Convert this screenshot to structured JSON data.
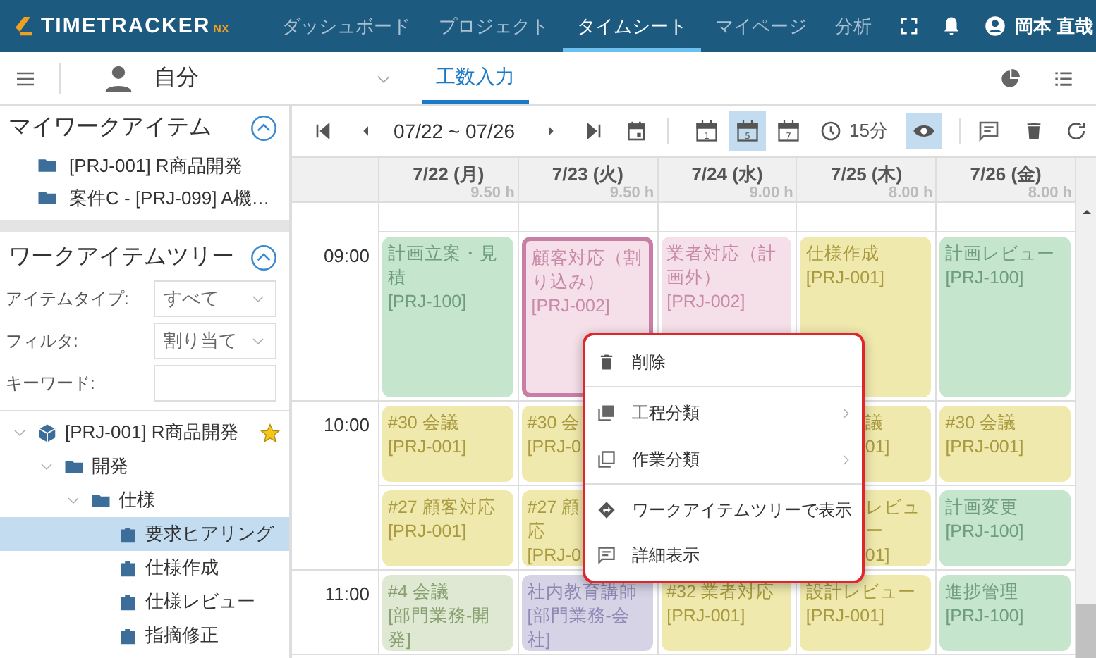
{
  "header": {
    "logo": {
      "text": "TIMETRACKER",
      "suffix": "NX"
    },
    "nav": [
      {
        "label": "ダッシュボード",
        "selected": false
      },
      {
        "label": "プロジェクト",
        "selected": false
      },
      {
        "label": "タイムシート",
        "selected": true
      },
      {
        "label": "マイページ",
        "selected": false
      },
      {
        "label": "分析",
        "selected": false
      }
    ],
    "user": "岡本 直哉"
  },
  "subbar": {
    "person": "自分",
    "tabs": [
      {
        "label": "工数入力",
        "selected": true
      }
    ]
  },
  "my_work_items": {
    "title": "マイワークアイテム",
    "expanded": true,
    "items": [
      {
        "label": "[PRJ-001] R商品開発"
      },
      {
        "label": "案件C - [PRJ-099] A機…"
      }
    ]
  },
  "work_item_tree": {
    "title": "ワークアイテムツリー",
    "expanded": true,
    "filters": [
      {
        "label": "アイテムタイプ:",
        "kind": "select",
        "value": "すべて"
      },
      {
        "label": "フィルタ:",
        "kind": "select",
        "value": "割り当て"
      },
      {
        "label": "キーワード:",
        "kind": "input"
      }
    ],
    "tree": [
      {
        "label": "[PRJ-001] R商品開発",
        "kind": "project",
        "expanded": true,
        "starred": true,
        "selected": false,
        "children": [
          {
            "label": "開発",
            "kind": "folder",
            "expanded": true,
            "selected": false,
            "children": [
              {
                "label": "仕様",
                "kind": "folder",
                "expanded": true,
                "selected": false,
                "children": [
                  {
                    "label": "要求ヒアリング",
                    "kind": "task",
                    "selected": true
                  },
                  {
                    "label": "仕様作成",
                    "kind": "task",
                    "selected": false
                  },
                  {
                    "label": "仕様レビュー",
                    "kind": "task",
                    "selected": false
                  },
                  {
                    "label": "指摘修正",
                    "kind": "task",
                    "selected": false
                  }
                ]
              }
            ]
          }
        ]
      }
    ]
  },
  "toolbar": {
    "range": "07/22 ~ 07/26",
    "views": [
      {
        "label": "1",
        "selected": false
      },
      {
        "label": "5",
        "selected": true
      },
      {
        "label": "7",
        "selected": false
      }
    ],
    "interval": "15分",
    "preview_on": true
  },
  "calendar": {
    "days": [
      {
        "label": "7/22 (月)",
        "total": "9.50 h"
      },
      {
        "label": "7/23 (火)",
        "total": "9.50 h"
      },
      {
        "label": "7/24 (水)",
        "total": "9.00 h"
      },
      {
        "label": "7/25 (木)",
        "total": "8.00 h"
      },
      {
        "label": "7/26 (金)",
        "total": "8.00 h"
      }
    ],
    "rows": [
      {
        "label": "09:00",
        "cells": [
          {
            "kind": "tall",
            "lines": [
              "計画立案・見積",
              "[PRJ-100]"
            ],
            "color": "#c5e5cc",
            "selected": false
          },
          {
            "kind": "tall",
            "lines": [
              "顧客対応（割り込み）",
              "[PRJ-002]"
            ],
            "color": "#f5dfe9",
            "selected": true
          },
          {
            "kind": "tall",
            "lines": [
              "業者対応（計画外）",
              "[PRJ-002]"
            ],
            "color": "#f5dfe9",
            "selected": false
          },
          {
            "kind": "tall",
            "lines": [
              "仕様作成",
              "[PRJ-001]"
            ],
            "color": "#f0e9ad",
            "selected": false
          },
          {
            "kind": "tall",
            "lines": [
              "計画レビュー",
              "[PRJ-100]"
            ],
            "color": "#c5e5cc",
            "selected": false
          }
        ]
      },
      {
        "label": "10:00",
        "cells": [
          {
            "kind": "short",
            "lines": [
              "#30 会議",
              "[PRJ-001]"
            ],
            "color": "#f0e9ad",
            "selected": false
          },
          {
            "kind": "short",
            "lines": [
              "#30 会",
              "[PRJ-0"
            ],
            "color": "#f0e9ad",
            "selected": false
          },
          null,
          {
            "kind": "short_cut",
            "lines": [
              "議",
              "01]"
            ],
            "color": "#f0e9ad",
            "selected": false
          },
          {
            "kind": "short",
            "lines": [
              "#30 会議",
              "[PRJ-001]"
            ],
            "color": "#f0e9ad",
            "selected": false
          }
        ]
      },
      {
        "cells": [
          {
            "kind": "short",
            "lines": [
              "#27 顧客対応",
              "[PRJ-001]"
            ],
            "color": "#f0e9ad",
            "selected": false
          },
          {
            "kind": "short",
            "lines": [
              "#27 顧",
              "応",
              "[PRJ-0"
            ],
            "color": "#f0e9ad",
            "selected": false
          },
          null,
          {
            "kind": "short_cut",
            "lines": [
              "レビュー",
              "01]"
            ],
            "color": "#f0e9ad",
            "selected": false
          },
          {
            "kind": "short",
            "lines": [
              "計画変更",
              "[PRJ-100]"
            ],
            "color": "#c5e5cc",
            "selected": false
          }
        ]
      },
      {
        "label": "11:00",
        "cells": [
          {
            "kind": "short",
            "lines": [
              "#4 会議",
              "[部門業務-開発]"
            ],
            "color": "#dfe8d2",
            "selected": false
          },
          {
            "kind": "short",
            "lines": [
              "社内教育講師",
              "[部門業務-会社]"
            ],
            "color": "#d6d3e6",
            "selected": false
          },
          {
            "kind": "short",
            "lines": [
              "#32 業者対応",
              "[PRJ-001]"
            ],
            "color": "#f0e9ad",
            "selected": false
          },
          {
            "kind": "short",
            "lines": [
              "設計レビュー",
              "[PRJ-001]"
            ],
            "color": "#f0e9ad",
            "selected": false
          },
          {
            "kind": "short",
            "lines": [
              "進捗管理",
              "[PRJ-100]"
            ],
            "color": "#c5e5cc",
            "selected": false
          }
        ]
      }
    ]
  },
  "context_menu": {
    "items": [
      {
        "label": "削除",
        "submenu": false,
        "divider_after": true
      },
      {
        "label": "工程分類",
        "submenu": true,
        "divider_after": false
      },
      {
        "label": "作業分類",
        "submenu": true,
        "divider_after": true
      },
      {
        "label": "ワークアイテムツリーで表示",
        "submenu": false,
        "divider_after": false
      },
      {
        "label": "詳細表示",
        "submenu": false,
        "divider_after": false
      }
    ]
  }
}
